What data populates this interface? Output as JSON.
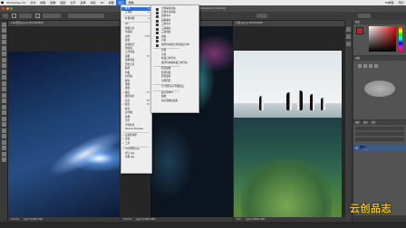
{
  "menubar": {
    "items": [
      "Photoshop CC",
      "文件",
      "编辑",
      "图像",
      "图层",
      "文字",
      "选择",
      "滤镜",
      "3D",
      "视图",
      "窗口",
      "帮助"
    ],
    "active_index": 10,
    "right_time": "周四",
    "right_label": "PS教程"
  },
  "app": {
    "title": "Adobe Photoshop CC (64 Bit)"
  },
  "tabs": [
    "mac壁纸.jpg @ 25%(RGB/8)",
    "星空.jpg @ 33.3%(RGB/8)",
    "企鹅.jpg @ 50%(RGB/8)"
  ],
  "status": [
    "33.33%",
    "文档:5.93M/5.93M",
    "33.33%",
    "文档:5.93M/5.93M",
    "50%",
    "文档:1.58M/1.58M"
  ],
  "window_menu": {
    "items": [
      {
        "label": "排列",
        "hl": true,
        "arrow": "▸"
      },
      {
        "label": "工作区",
        "arrow": "▸"
      },
      {
        "sep": true
      },
      {
        "label": "扩展功能",
        "arrow": "▸"
      },
      {
        "sep": true
      },
      {
        "label": "3D"
      },
      {
        "label": "测量记录"
      },
      {
        "label": "导航器"
      },
      {
        "label": "动作",
        "sc": "⌥F9"
      },
      {
        "label": "段落"
      },
      {
        "label": "段落样式"
      },
      {
        "label": "仿制源"
      },
      {
        "label": "工具预设"
      },
      {
        "label": "画笔",
        "sc": "F5"
      },
      {
        "label": "画笔预设"
      },
      {
        "label": "历史记录"
      },
      {
        "label": "路径"
      },
      {
        "label": "色板"
      },
      {
        "label": "时间轴"
      },
      {
        "label": "属性"
      },
      {
        "label": "调整"
      },
      {
        "label": "通道"
      },
      {
        "label": "图层",
        "ck": true,
        "sc": "F7"
      },
      {
        "label": "图层复合"
      },
      {
        "label": "信息",
        "sc": "F8"
      },
      {
        "label": "颜色",
        "ck": true,
        "sc": "F6"
      },
      {
        "label": "样式"
      },
      {
        "label": "直方图"
      },
      {
        "label": "注释"
      },
      {
        "label": "字符"
      },
      {
        "label": "字符样式"
      },
      {
        "label": "Device Preview"
      },
      {
        "sep": true
      },
      {
        "label": "应用程序框",
        "ck": true
      },
      {
        "label": "选项",
        "ck": true
      },
      {
        "label": "工具",
        "ck": true
      },
      {
        "sep": true
      },
      {
        "label": "mac壁纸.jpg",
        "ck": true
      },
      {
        "label": "星空.jpg"
      },
      {
        "label": "企鹅.jpg"
      }
    ]
  },
  "arrange_submenu": {
    "items": [
      {
        "label": "全部垂直拼贴",
        "icon": true
      },
      {
        "label": "全部水平拼贴",
        "icon": true
      },
      {
        "label": "双联水平",
        "icon": true
      },
      {
        "label": "双联垂直",
        "icon": true
      },
      {
        "label": "三联水平",
        "icon": true
      },
      {
        "label": "三联垂直",
        "icon": true
      },
      {
        "label": "三联堆积",
        "icon": true
      },
      {
        "label": "四联",
        "icon": true
      },
      {
        "label": "六联",
        "icon": true
      },
      {
        "label": "将所有内容合并到选项卡中",
        "icon": true
      },
      {
        "sep": true
      },
      {
        "label": "层叠"
      },
      {
        "label": "平铺"
      },
      {
        "label": "在窗口中浮动"
      },
      {
        "label": "使所有内容在窗口中浮动"
      },
      {
        "sep": true
      },
      {
        "label": "匹配缩放"
      },
      {
        "label": "匹配位置"
      },
      {
        "label": "匹配旋转"
      },
      {
        "label": "全部匹配"
      },
      {
        "sep": true
      },
      {
        "label": "为\"企鹅.jpg\"新建窗口"
      },
      {
        "sep": true
      },
      {
        "label": "最小化",
        "sc": "⌘M"
      },
      {
        "label": "缩放"
      },
      {
        "label": "将全部放在最前"
      }
    ]
  },
  "watermark": "云创品志",
  "panels": {
    "color_tab": "颜色",
    "adjust_tab": "调整",
    "layers_tab": "图层",
    "layers_channels": "通道",
    "layers_paths": "路径"
  },
  "colors": {
    "accent": "#2f6fd6",
    "menu_bg": "#eeeeee",
    "panel_bg": "#535353",
    "watermark": "#f2c21b"
  }
}
